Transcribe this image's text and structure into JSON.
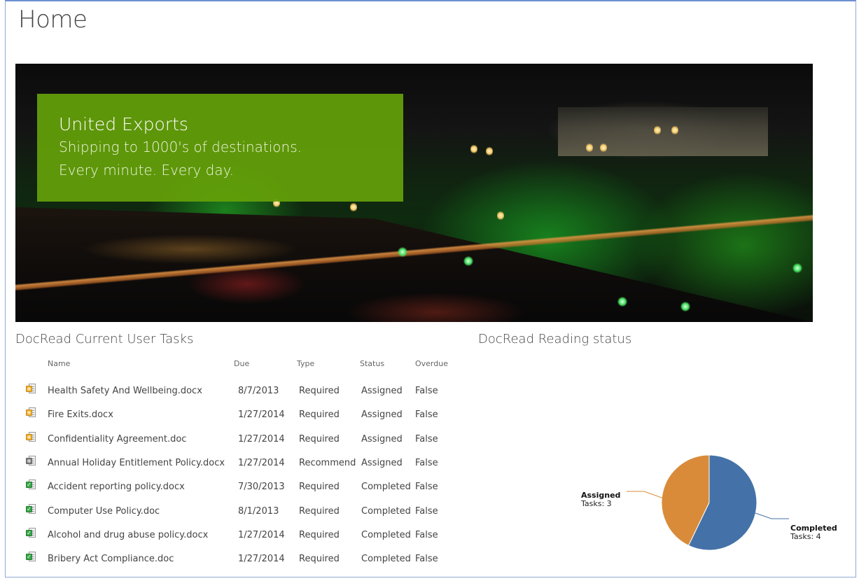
{
  "page": {
    "title": "Home"
  },
  "hero": {
    "heading": "United Exports",
    "line1": "Shipping to 1000's of destinations.",
    "line2": "Every minute. Every day."
  },
  "tasks": {
    "title": "DocRead Current User Tasks",
    "columns": {
      "name": "Name",
      "due": "Due",
      "type": "Type",
      "status": "Status",
      "overdue": "Overdue"
    },
    "rows": [
      {
        "icon": "doc-assigned-icon",
        "name": "Health Safety And Wellbeing.docx",
        "due": "8/7/2013",
        "type": "Required",
        "status": "Assigned",
        "overdue": "False"
      },
      {
        "icon": "doc-assigned-icon",
        "name": "Fire Exits.docx",
        "due": "1/27/2014",
        "type": "Required",
        "status": "Assigned",
        "overdue": "False"
      },
      {
        "icon": "doc-assigned-icon",
        "name": "Confidentiality Agreement.doc",
        "due": "1/27/2014",
        "type": "Required",
        "status": "Assigned",
        "overdue": "False"
      },
      {
        "icon": "doc-recommended-icon",
        "name": "Annual Holiday Entitlement Policy.docx",
        "due": "1/27/2014",
        "type": "Recommend",
        "status": "Assigned",
        "overdue": "False"
      },
      {
        "icon": "doc-completed-icon",
        "name": "Accident reporting policy.docx",
        "due": "7/30/2013",
        "type": "Required",
        "status": "Completed",
        "overdue": "False"
      },
      {
        "icon": "doc-completed-icon",
        "name": "Computer Use Policy.doc",
        "due": "8/1/2013",
        "type": "Required",
        "status": "Completed",
        "overdue": "False"
      },
      {
        "icon": "doc-completed-icon",
        "name": "Alcohol and drug abuse policy.docx",
        "due": "1/27/2014",
        "type": "Required",
        "status": "Completed",
        "overdue": "False"
      },
      {
        "icon": "doc-completed-icon",
        "name": "Bribery Act Compliance.doc",
        "due": "1/27/2014",
        "type": "Required",
        "status": "Completed",
        "overdue": "False"
      }
    ]
  },
  "reading_status": {
    "title": "DocRead Reading status",
    "chart_data": {
      "type": "pie",
      "title": "",
      "slices": [
        {
          "label": "Completed",
          "detail": "Tasks: 4",
          "value": 4,
          "color": "#4472a8"
        },
        {
          "label": "Assigned",
          "detail": "Tasks: 3",
          "value": 3,
          "color": "#d98b3a"
        }
      ]
    }
  },
  "colors": {
    "hero_box": "#64a00a",
    "frame_border": "#8fa9d6",
    "badge_assigned": "#f2b53a",
    "badge_recommend": "#8a8a8a",
    "badge_completed": "#3aa84a"
  }
}
